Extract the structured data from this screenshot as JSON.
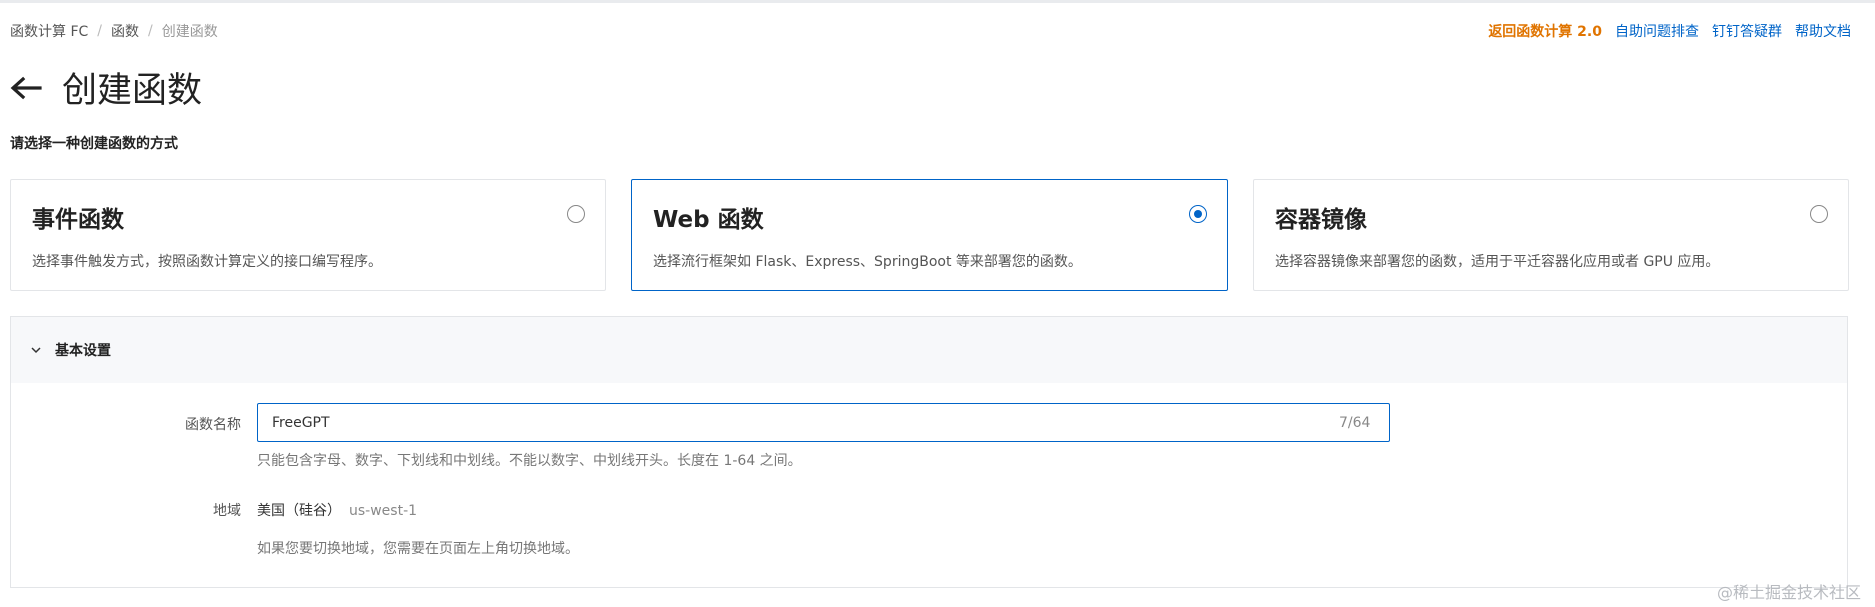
{
  "breadcrumb": {
    "items": [
      "函数计算 FC",
      "函数",
      "创建函数"
    ],
    "separator": "/"
  },
  "header_links": {
    "return_v2": "返回函数计算 2.0",
    "self_help": "自助问题排查",
    "dingtalk": "钉钉答疑群",
    "help_docs": "帮助文档"
  },
  "page": {
    "title": "创建函数",
    "subtitle": "请选择一种创建函数的方式"
  },
  "cards": [
    {
      "title": "事件函数",
      "description": "选择事件触发方式，按照函数计算定义的接口编写程序。",
      "selected": false
    },
    {
      "title": "Web 函数",
      "description": "选择流行框架如 Flask、Express、SpringBoot 等来部署您的函数。",
      "selected": true
    },
    {
      "title": "容器镜像",
      "description": "选择容器镜像来部署您的函数，适用于平迁容器化应用或者 GPU 应用。",
      "selected": false
    }
  ],
  "basic_settings": {
    "header": "基本设置",
    "function_name": {
      "label": "函数名称",
      "value": "FreeGPT",
      "counter": "7/64",
      "hint": "只能包含字母、数字、下划线和中划线。不能以数字、中划线开头。长度在 1-64 之间。"
    },
    "region": {
      "label": "地域",
      "value": "美国（硅谷）",
      "code": "us-west-1",
      "hint": "如果您要切换地域，您需要在页面左上角切换地域。"
    }
  },
  "watermark": "@稀土掘金技术社区",
  "colors": {
    "primary": "#0064c8",
    "accent": "#e07400",
    "border": "#e3e5e8",
    "header_bg": "#f7f8fa"
  }
}
